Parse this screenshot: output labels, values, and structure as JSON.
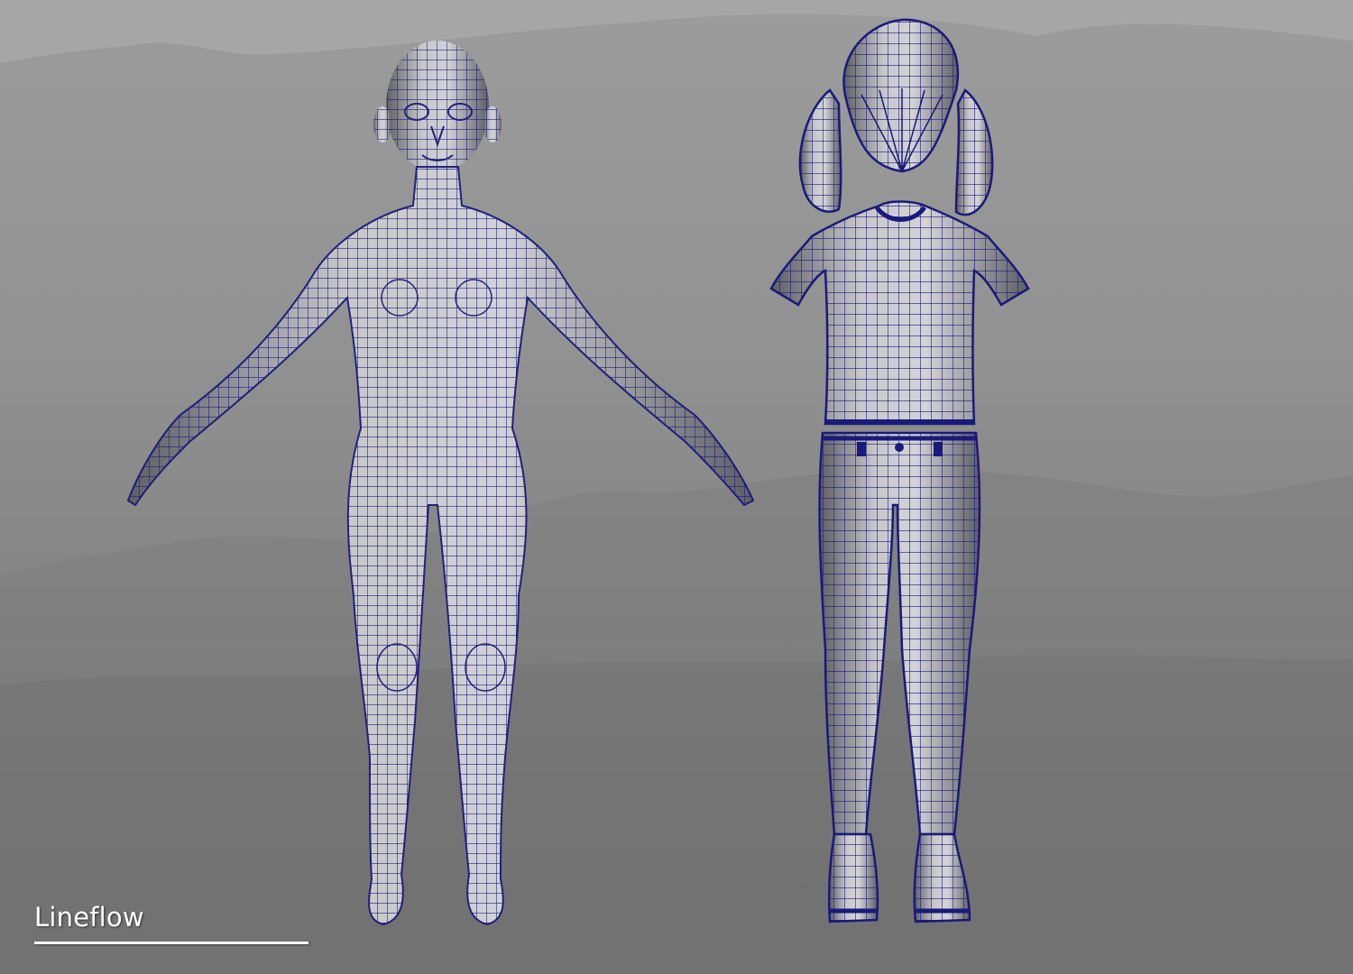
{
  "caption": {
    "text": "Lineflow"
  },
  "colors": {
    "wire": "#1a1a7a",
    "mesh_light": "#c8c8cc",
    "mesh_dark": "#5e5e66",
    "caption": "#ffffff"
  },
  "scene": {
    "objects": [
      "base-body-mesh",
      "hair-mesh",
      "tshirt-mesh",
      "pants-mesh",
      "boots-mesh"
    ]
  }
}
